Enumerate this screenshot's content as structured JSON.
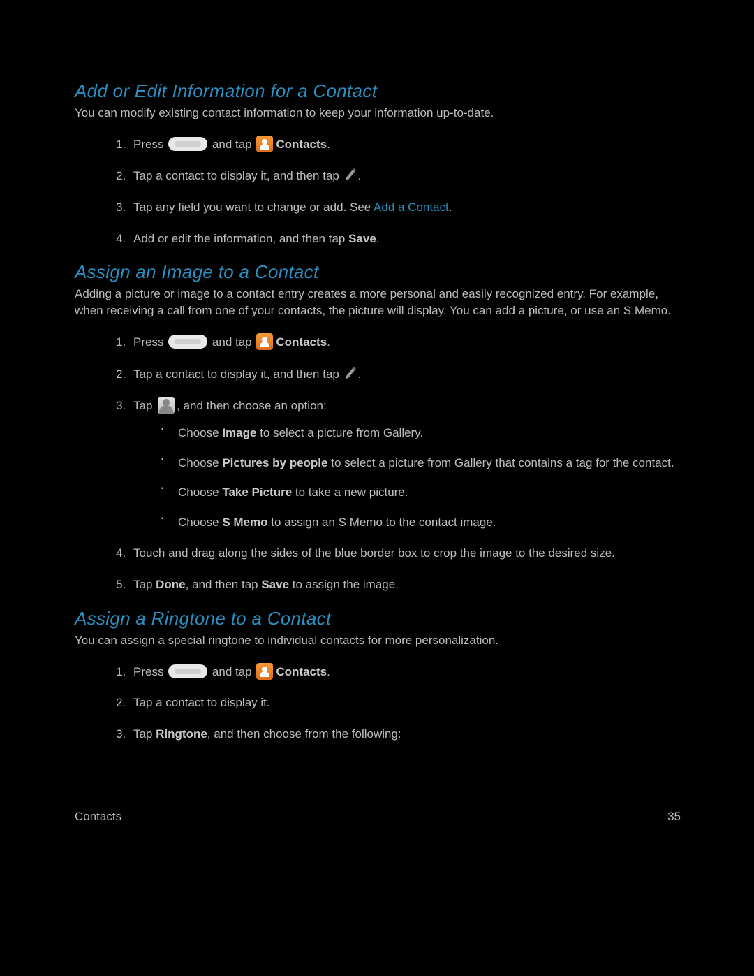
{
  "section1": {
    "heading": "Add or Edit Information for a Contact",
    "intro": "You can modify existing contact information to keep your information up-to-date.",
    "step1_a": "Press ",
    "step1_b": " and tap ",
    "step1_contacts": "Contacts",
    "step1_end": ".",
    "step2_a": "Tap a contact to display it, and then tap ",
    "step2_end": ".",
    "step3_a": "Tap any field you want to change or add. See ",
    "step3_link": "Add a Contact",
    "step3_end": ".",
    "step4_a": "Add or edit the information, and then tap ",
    "step4_save": "Save",
    "step4_end": "."
  },
  "section2": {
    "heading": "Assign an Image to a Contact",
    "intro": "Adding a picture or image to a contact entry creates a more personal and easily recognized entry. For example, when receiving a call from one of your contacts, the picture will display. You can add a picture, or use an S Memo.",
    "step1_a": "Press ",
    "step1_b": " and tap ",
    "step1_contacts": "Contacts",
    "step1_end": ".",
    "step2_a": "Tap a contact to display it, and then tap ",
    "step2_end": ".",
    "step3_a": "Tap ",
    "step3_b": ", and then choose an option:",
    "sub1_a": "Choose ",
    "sub1_bold": "Image",
    "sub1_b": " to select a picture from Gallery.",
    "sub2_a": "Choose ",
    "sub2_bold": "Pictures by people",
    "sub2_b": " to select a picture from Gallery that contains a tag for the contact.",
    "sub3_a": "Choose ",
    "sub3_bold": "Take Picture",
    "sub3_b": " to take a new picture.",
    "sub4_a": "Choose ",
    "sub4_bold": "S Memo",
    "sub4_b": " to assign an S Memo to the contact image.",
    "step4": "Touch and drag along the sides of the blue border box to crop the image to the desired size.",
    "step5_a": "Tap ",
    "step5_done": "Done",
    "step5_b": ", and then tap ",
    "step5_save": "Save",
    "step5_c": " to assign the image."
  },
  "section3": {
    "heading": "Assign a Ringtone to a Contact",
    "intro": "You can assign a special ringtone to individual contacts for more personalization.",
    "step1_a": "Press ",
    "step1_b": " and tap ",
    "step1_contacts": "Contacts",
    "step1_end": ".",
    "step2": "Tap a contact to display it.",
    "step3_a": "Tap ",
    "step3_bold": "Ringtone",
    "step3_b": ", and then choose from the following:"
  },
  "footer": {
    "left": "Contacts",
    "right": "35"
  }
}
